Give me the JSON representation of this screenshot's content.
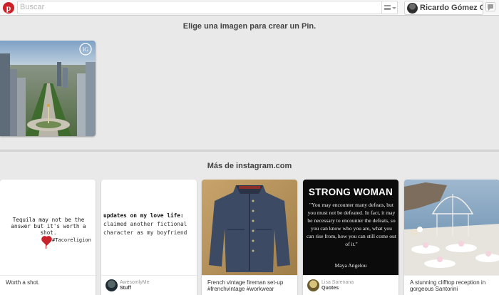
{
  "header": {
    "logo_letter": "p",
    "search_placeholder": "Buscar",
    "user_name": "Ricardo Gómez G..."
  },
  "main": {
    "choose_title": "Elige una imagen para crear un Pin.",
    "more_title": "Más de instagram.com"
  },
  "pins": [
    {
      "quote": "Tequila may not be the answer but it's worth a shot.",
      "hashtag": "#Tacoreligion",
      "description": "Worth a shot."
    },
    {
      "quote_bold": "updates on my love life:",
      "quote_rest": "claimed another fictional character as my boyfriend",
      "user": "AwesomlyMe",
      "board": "Stuff"
    },
    {
      "description": "French vintage fireman set-up #frenchvintage #workwear"
    },
    {
      "title": "STRONG WOMAN",
      "quote": "\"You may encounter many defeats, but you must not be defeated. In fact, it may be necessary to encounter the defeats, so you can know who you are, what you can rise from, how you can still come out of it.\"",
      "author": "Maya Angelou",
      "user": "Lisa Sarenana",
      "board": "Quotes"
    },
    {
      "description": "A stunning clifftop reception in gorgeous Santorini"
    }
  ],
  "colors": {
    "brand": "#cb2027",
    "page_bg": "#e9e9e9"
  }
}
